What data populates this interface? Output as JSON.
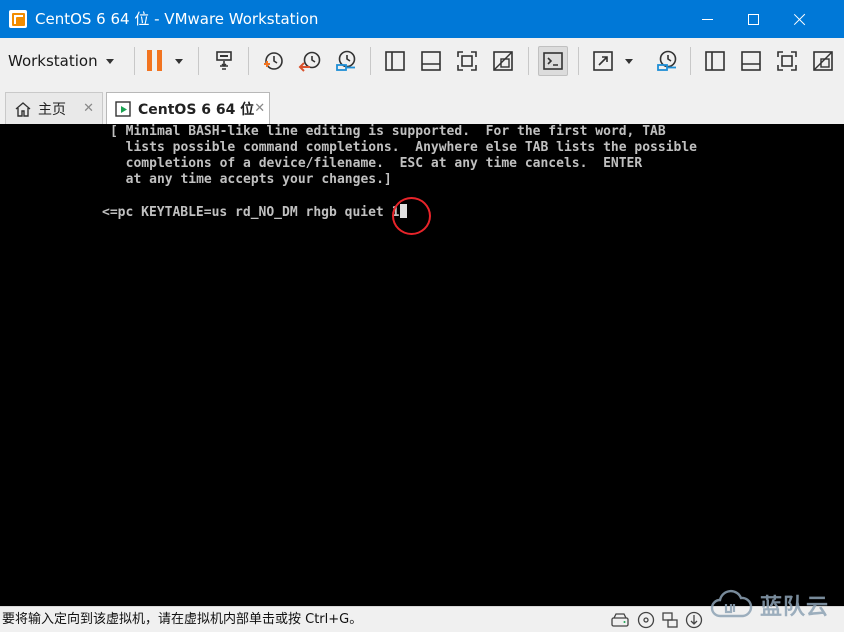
{
  "window": {
    "title": "CentOS 6 64 位 - VMware Workstation",
    "accent_color": "#0078d7"
  },
  "toolbar": {
    "menu_label": "Workstation",
    "pause_color": "#f27420",
    "icons": [
      "network-adapter-icon",
      "snapshot-take-icon",
      "snapshot-revert-icon",
      "snapshot-manager-icon",
      "show-library-icon",
      "thumbnail-bar-icon",
      "full-screen-icon",
      "unity-icon",
      "console-view-icon",
      "stretch-guest-icon",
      "snapshot-icon-2"
    ]
  },
  "tabs": [
    {
      "label": "主页",
      "icon": "home-icon"
    },
    {
      "label": "CentOS 6 64 位",
      "icon": "vm-running-icon",
      "active": true
    }
  ],
  "console": {
    "lines": [
      "[ Minimal BASH-like line editing is supported.  For the first word, TAB",
      "  lists possible command completions.  Anywhere else TAB lists the possible",
      "  completions of a device/filename.  ESC at any time cancels.  ENTER",
      "  at any time accepts your changes.]"
    ],
    "command": "<=pc KEYTABLE=us rd_NO_DM rhgb quiet 1",
    "highlight_color": "#e8242a"
  },
  "statusbar": {
    "message": "要将输入定向到该虚拟机，请在虚拟机内部单击或按 Ctrl+G。"
  },
  "watermark": {
    "text": "蓝队云"
  }
}
